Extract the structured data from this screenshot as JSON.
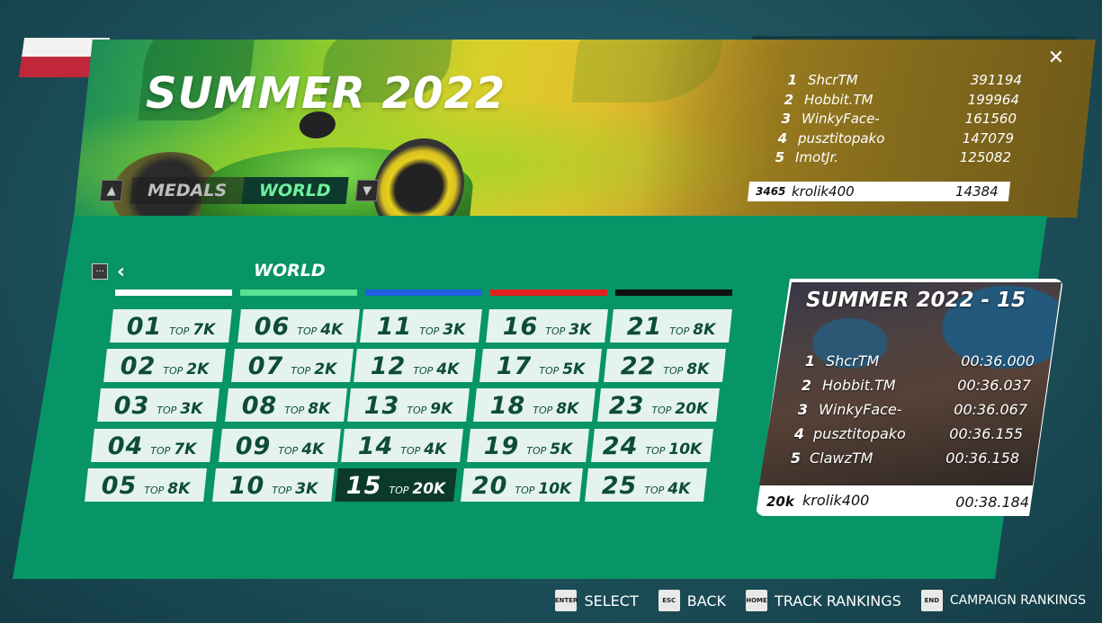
{
  "campaign": {
    "title": "SUMMER 2022",
    "close_icon": "✕",
    "tabs": [
      {
        "label": "MEDALS",
        "active": false
      },
      {
        "label": "WORLD",
        "active": true
      }
    ],
    "leaderboard": [
      {
        "rank": "1",
        "name": "ShcrTM",
        "score": "391194"
      },
      {
        "rank": "2",
        "name": "Hobbit.TM",
        "score": "199964"
      },
      {
        "rank": "3",
        "name": "WinkyFace-",
        "score": "161560"
      },
      {
        "rank": "4",
        "name": "pusztitopako",
        "score": "147079"
      },
      {
        "rank": "5",
        "name": "ImotJr.",
        "score": "125082"
      }
    ],
    "player": {
      "rank": "3465",
      "name": "krolik400",
      "score": "14384"
    }
  },
  "panel": {
    "zone_title": "WORLD",
    "back_icon": "‹",
    "menu_icon": "···",
    "color_bars": [
      "#ffffff",
      "#59e28f",
      "#1e5fe0",
      "#e0201e",
      "#111111"
    ]
  },
  "tracks": [
    {
      "num": "01",
      "top": "TOP",
      "rank": "7K"
    },
    {
      "num": "02",
      "top": "TOP",
      "rank": "2K"
    },
    {
      "num": "03",
      "top": "TOP",
      "rank": "3K"
    },
    {
      "num": "04",
      "top": "TOP",
      "rank": "7K"
    },
    {
      "num": "05",
      "top": "TOP",
      "rank": "8K"
    },
    {
      "num": "06",
      "top": "TOP",
      "rank": "4K"
    },
    {
      "num": "07",
      "top": "TOP",
      "rank": "2K"
    },
    {
      "num": "08",
      "top": "TOP",
      "rank": "8K"
    },
    {
      "num": "09",
      "top": "TOP",
      "rank": "4K"
    },
    {
      "num": "10",
      "top": "TOP",
      "rank": "3K"
    },
    {
      "num": "11",
      "top": "TOP",
      "rank": "3K"
    },
    {
      "num": "12",
      "top": "TOP",
      "rank": "4K"
    },
    {
      "num": "13",
      "top": "TOP",
      "rank": "9K"
    },
    {
      "num": "14",
      "top": "TOP",
      "rank": "4K"
    },
    {
      "num": "15",
      "top": "TOP",
      "rank": "20K",
      "selected": true
    },
    {
      "num": "16",
      "top": "TOP",
      "rank": "3K"
    },
    {
      "num": "17",
      "top": "TOP",
      "rank": "5K"
    },
    {
      "num": "18",
      "top": "TOP",
      "rank": "8K"
    },
    {
      "num": "19",
      "top": "TOP",
      "rank": "5K"
    },
    {
      "num": "20",
      "top": "TOP",
      "rank": "10K"
    },
    {
      "num": "21",
      "top": "TOP",
      "rank": "8K"
    },
    {
      "num": "22",
      "top": "TOP",
      "rank": "8K"
    },
    {
      "num": "23",
      "top": "TOP",
      "rank": "20K"
    },
    {
      "num": "24",
      "top": "TOP",
      "rank": "10K"
    },
    {
      "num": "25",
      "top": "TOP",
      "rank": "4K"
    }
  ],
  "track_card": {
    "title": "SUMMER 2022 - 15",
    "rows": [
      {
        "rank": "1",
        "name": "ShcrTM",
        "time": "00:36.000"
      },
      {
        "rank": "2",
        "name": "Hobbit.TM",
        "time": "00:36.037"
      },
      {
        "rank": "3",
        "name": "WinkyFace-",
        "time": "00:36.067"
      },
      {
        "rank": "4",
        "name": "pusztitopako",
        "time": "00:36.155"
      },
      {
        "rank": "5",
        "name": "ClawzTM",
        "time": "00:36.158"
      }
    ],
    "player": {
      "rank": "20k",
      "name": "krolik400",
      "time": "00:38.184"
    }
  },
  "footer": {
    "hints": [
      {
        "key": "ENTER",
        "label": "SELECT"
      },
      {
        "key": "ESC",
        "label": "BACK"
      },
      {
        "key": "HOME",
        "label": "TRACK RANKINGS"
      },
      {
        "key": "END",
        "label": "CAMPAIGN RANKINGS"
      }
    ]
  }
}
